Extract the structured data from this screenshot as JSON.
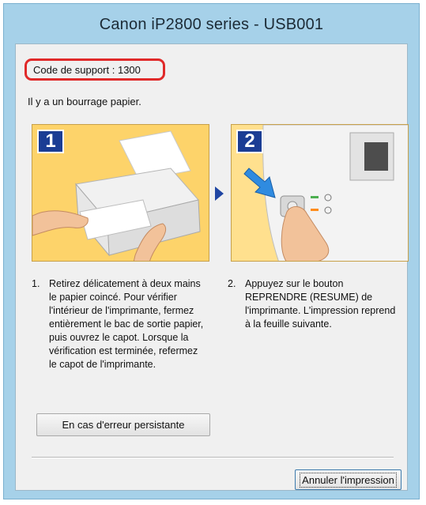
{
  "window": {
    "title": "Canon iP2800 series - USB001"
  },
  "dialog": {
    "support_code": "Code de support : 1300",
    "message": "Il y a un bourrage papier.",
    "steps": [
      {
        "badge": "1",
        "number": "1.",
        "text": "Retirez délicatement à deux mains le papier coincé. Pour vérifier l'intérieur de l'imprimante, fermez entièrement le bac de sortie papier, puis ouvrez le capot. Lorsque la vérification est terminée, refermez le capot de l'imprimante."
      },
      {
        "badge": "2",
        "number": "2.",
        "text": "Appuyez sur le bouton REPRENDRE (RESUME) de l'imprimante. L'impression reprend à la feuille suivante."
      }
    ],
    "persistent_error_label": "En cas d'erreur persistante",
    "cancel_label": "Annuler l'impression"
  },
  "colors": {
    "titlebar": "#a6d1e9",
    "support_code_border": "#e02a2a",
    "step_badge": "#1b3d94",
    "panel_background": "#fdd36a"
  },
  "icons": [
    "printer-illustration",
    "hand-icon",
    "resume-button-illustration",
    "arrow-right-icon"
  ]
}
